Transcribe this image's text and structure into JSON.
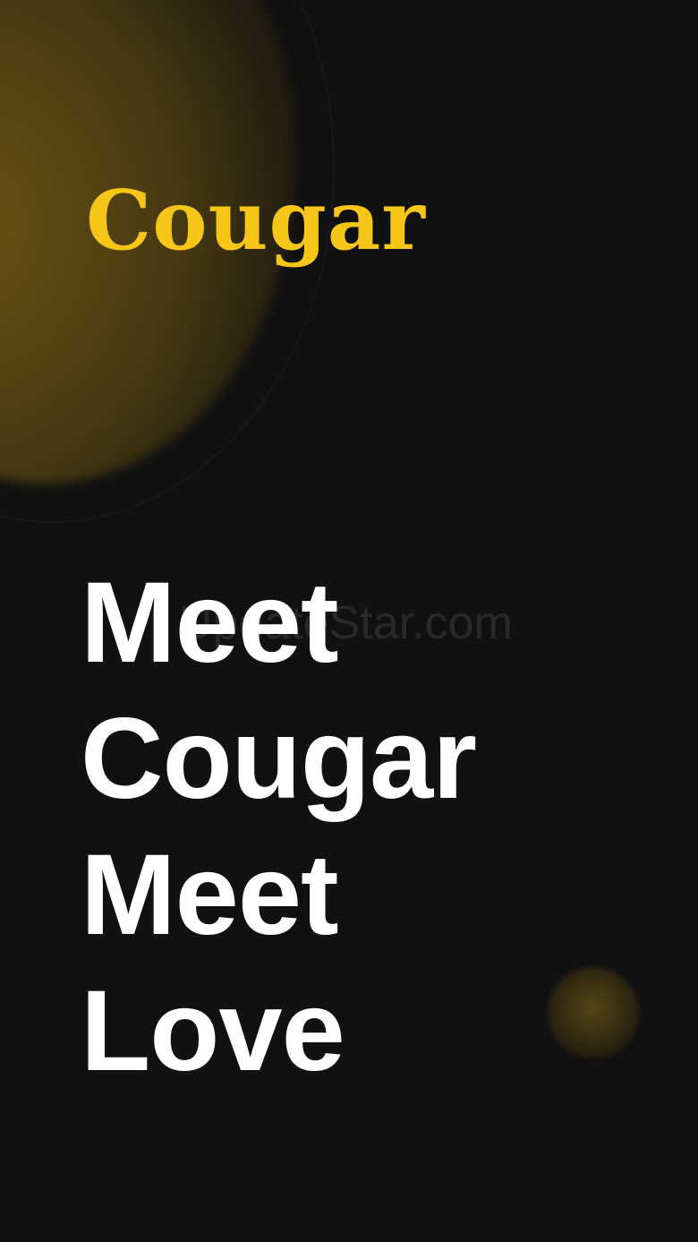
{
  "app": {
    "brand_name": "Cougar",
    "brand_color": "#F5C518",
    "background_color": "#111111"
  },
  "tagline": {
    "lines": [
      "Meet",
      "Cougar",
      "Meet",
      "Love"
    ]
  },
  "watermark": {
    "text": "UpdateStar.com"
  }
}
